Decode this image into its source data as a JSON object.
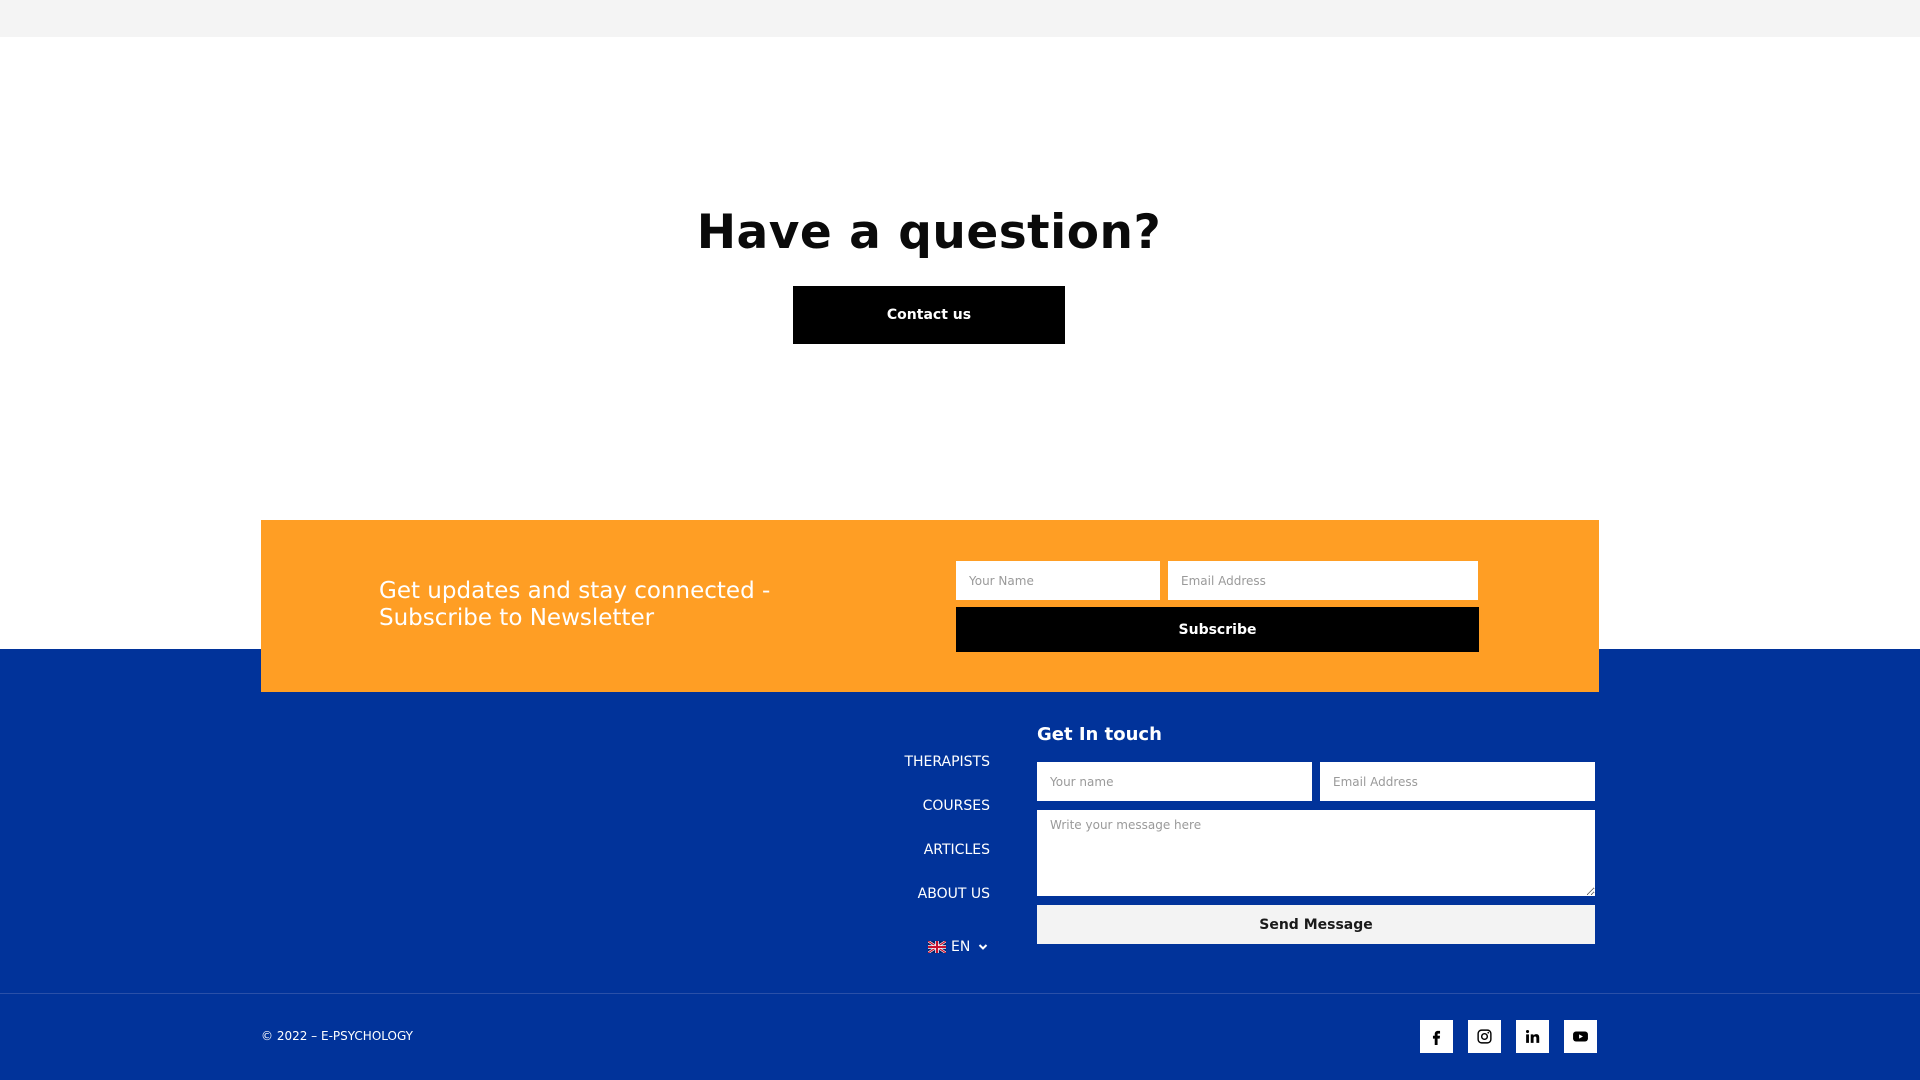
{
  "question": {
    "title": "Have a question?",
    "contact_label": "Contact us"
  },
  "newsletter": {
    "text": "Get updates and stay connected - Subscribe to Newsletter",
    "name_placeholder": "Your Name",
    "email_placeholder": "Email Address",
    "subscribe_label": "Subscribe",
    "bg_color": "#ff9e24"
  },
  "footer": {
    "bg_color": "#01339a",
    "nav": [
      {
        "label": "THERAPISTS"
      },
      {
        "label": "COURSES"
      },
      {
        "label": "ARTICLES"
      },
      {
        "label": "ABOUT US"
      }
    ],
    "language": {
      "label": "EN",
      "flag": "uk-flag-icon"
    },
    "get_in_touch": {
      "title": "Get In touch",
      "name_placeholder": "Your name",
      "email_placeholder": "Email Address",
      "message_placeholder": "Write your message here",
      "send_label": "Send Message"
    },
    "copyright": "© 2022 – E-PSYCHOLOGY",
    "socials": [
      {
        "icon": "facebook-icon"
      },
      {
        "icon": "instagram-icon"
      },
      {
        "icon": "linkedin-icon"
      },
      {
        "icon": "youtube-icon"
      }
    ]
  }
}
